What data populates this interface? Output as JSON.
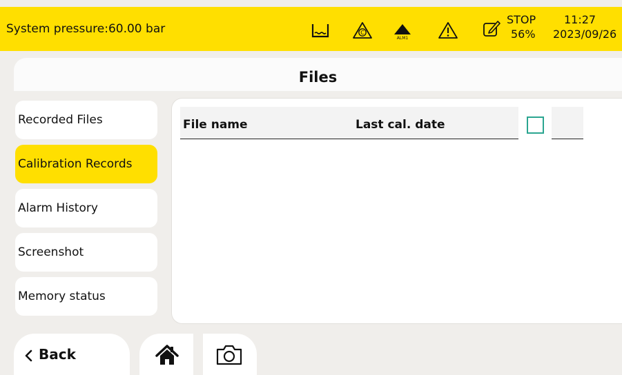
{
  "status": {
    "pressure_text": "System pressure:60.00 bar",
    "alarm_icon_label": "ALM1",
    "calibration_icon_label": "C",
    "run_state": "STOP",
    "percent": "56%",
    "time": "11:27",
    "date": "2023/09/26",
    "accent_color": "#ffdf00",
    "icons": [
      "tank-level-icon",
      "calibration-warning-icon",
      "alarm-icon",
      "warning-icon",
      "edit-icon"
    ]
  },
  "header": {
    "title": "Files"
  },
  "sidebar": {
    "items": [
      {
        "label": "Recorded Files",
        "active": false
      },
      {
        "label": "Calibration Records",
        "active": true
      },
      {
        "label": "Alarm History",
        "active": false
      },
      {
        "label": "Screenshot",
        "active": false
      },
      {
        "label": "Memory status",
        "active": false
      }
    ]
  },
  "table": {
    "columns": [
      "File name",
      "Last cal. date"
    ],
    "rows": [],
    "select_all_checked": false
  },
  "bottom": {
    "back_label": "Back",
    "icons": [
      "back-chevron-icon",
      "home-icon",
      "camera-icon"
    ]
  }
}
